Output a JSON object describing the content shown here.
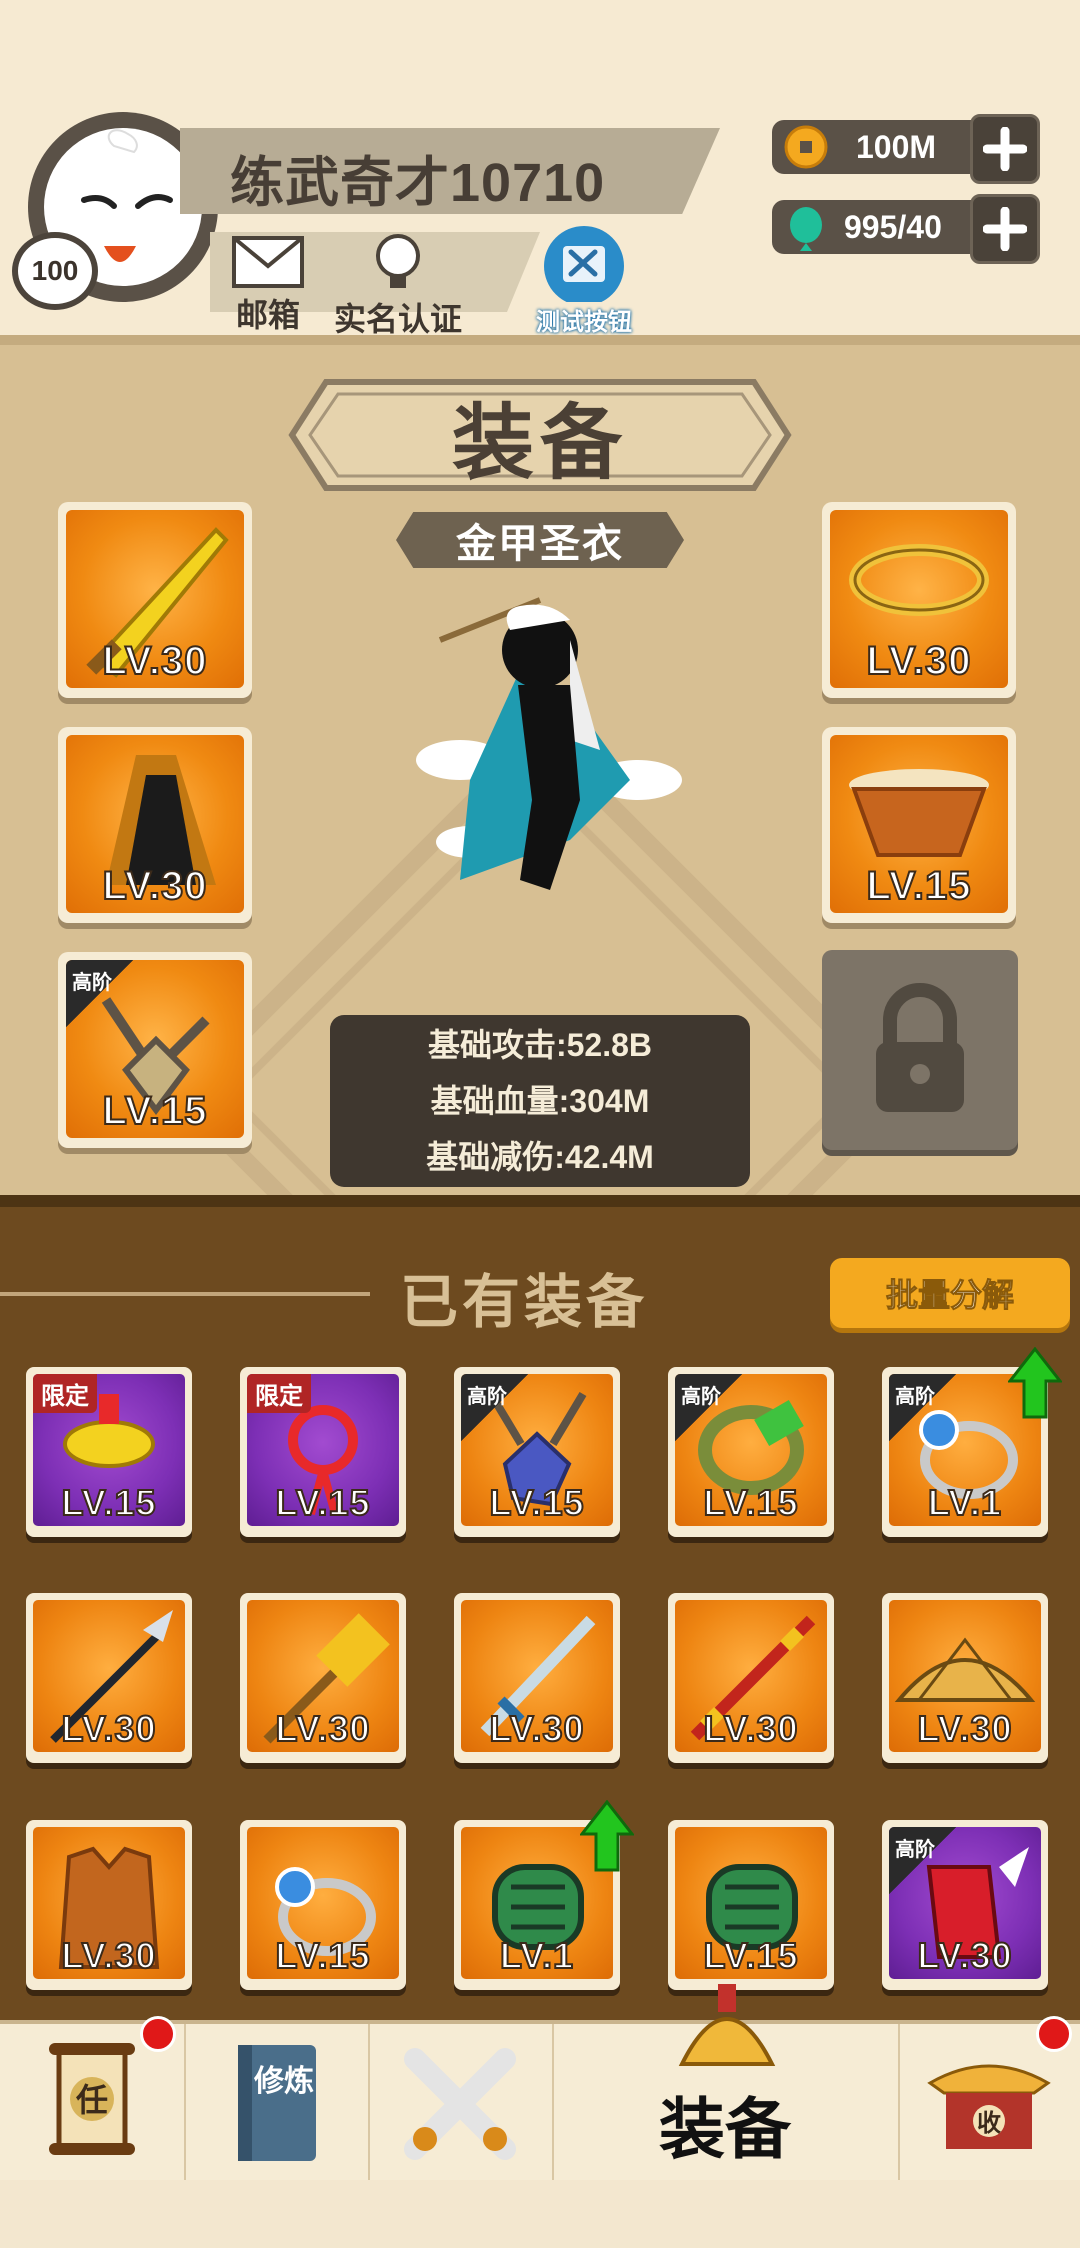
{
  "player": {
    "name": "练武奇才10710",
    "level": "100"
  },
  "header": {
    "mail_label": "邮箱",
    "verify_label": "实名认证",
    "test_label": "测试按钮"
  },
  "currency": {
    "coins": "100M",
    "gems": "995/40"
  },
  "equipment": {
    "title": "装备",
    "set_name": "金甲圣衣",
    "slots_left": [
      {
        "icon": "golden-saber-icon",
        "level": "LV.30",
        "tag": ""
      },
      {
        "icon": "black-cloak-icon",
        "level": "LV.30",
        "tag": ""
      },
      {
        "icon": "bronze-amulet-icon",
        "level": "LV.15",
        "tag": "高阶"
      }
    ],
    "slots_right": [
      {
        "icon": "golden-circlet-icon",
        "level": "LV.30",
        "tag": ""
      },
      {
        "icon": "woven-basket-hat-icon",
        "level": "LV.15",
        "tag": ""
      }
    ],
    "locked_slot_icon": "padlock-icon",
    "stats": {
      "attack": "基础攻击:52.8B",
      "hp": "基础血量:304M",
      "reduction": "基础减伤:42.4M"
    }
  },
  "owned": {
    "title": "已有装备",
    "batch_button": "批量分解",
    "items": [
      {
        "icon": "gold-ingot-charm-icon",
        "level": "LV.15",
        "tag": "限定",
        "bg": "purple",
        "upgrade": false
      },
      {
        "icon": "red-chinese-knot-icon",
        "level": "LV.15",
        "tag": "限定",
        "bg": "purple",
        "upgrade": false
      },
      {
        "icon": "sapphire-necklace-icon",
        "level": "LV.15",
        "tag": "高阶",
        "bg": "orange",
        "upgrade": false
      },
      {
        "icon": "jade-bracelet-icon",
        "level": "LV.15",
        "tag": "高阶",
        "bg": "orange",
        "upgrade": false
      },
      {
        "icon": "sapphire-ring-icon",
        "level": "LV.1",
        "tag": "高阶",
        "bg": "orange",
        "upgrade": true
      },
      {
        "icon": "spear-icon",
        "level": "LV.30",
        "tag": "",
        "bg": "orange",
        "upgrade": false
      },
      {
        "icon": "golden-hammer-icon",
        "level": "LV.30",
        "tag": "",
        "bg": "orange",
        "upgrade": false
      },
      {
        "icon": "steel-sword-icon",
        "level": "LV.30",
        "tag": "",
        "bg": "orange",
        "upgrade": false
      },
      {
        "icon": "red-staff-icon",
        "level": "LV.30",
        "tag": "",
        "bg": "orange",
        "upgrade": false
      },
      {
        "icon": "straw-hat-icon",
        "level": "LV.30",
        "tag": "",
        "bg": "orange",
        "upgrade": false
      },
      {
        "icon": "leather-vest-icon",
        "level": "LV.30",
        "tag": "",
        "bg": "orange",
        "upgrade": false
      },
      {
        "icon": "blue-gem-ring-icon",
        "level": "LV.15",
        "tag": "",
        "bg": "orange",
        "upgrade": false
      },
      {
        "icon": "green-bracer-icon",
        "level": "LV.1",
        "tag": "",
        "bg": "orange",
        "upgrade": true
      },
      {
        "icon": "green-bracer-icon",
        "level": "LV.15",
        "tag": "",
        "bg": "orange",
        "upgrade": false
      },
      {
        "icon": "red-gauntlet-icon",
        "level": "LV.30",
        "tag": "高阶",
        "bg": "purple",
        "upgrade": false
      }
    ]
  },
  "nav": {
    "task_char": "任",
    "train_label": "修炼",
    "equip_label": "装备",
    "collect_char": "收"
  },
  "colors": {
    "orange_bg": "#f08a12",
    "purple_bg": "#7d2fb5",
    "panel": "#d7bf93",
    "owned_panel": "#6d4a1f",
    "button": "#f4a91f",
    "red_dot": "#e01818",
    "upgrade_arrow": "#22c51e"
  }
}
